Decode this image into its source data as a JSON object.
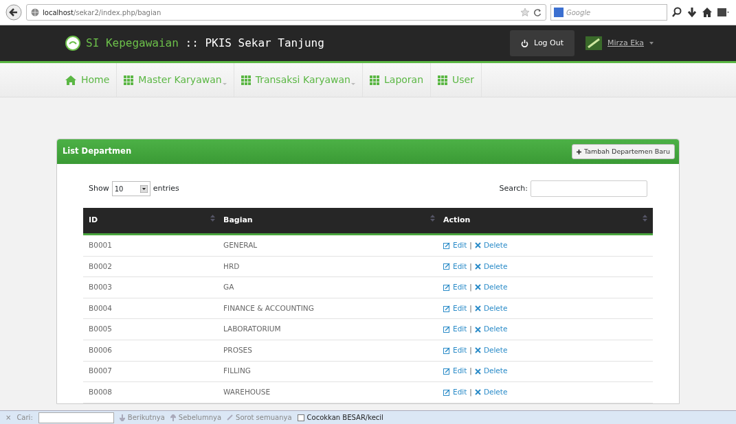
{
  "browser": {
    "url_host": "localhost",
    "url_path": "/sekar2/index.php/bagian",
    "search_placeholder": "Google"
  },
  "header": {
    "brand": "SI Kepegawaian",
    "brand_suffix": " :: PKIS Sekar Tanjung",
    "logout": "Log Out",
    "user": "Mirza Eka"
  },
  "nav": [
    {
      "label": "Home",
      "kind": "home",
      "dropdown": false
    },
    {
      "label": "Master Karyawan",
      "kind": "module",
      "dropdown": true
    },
    {
      "label": "Transaksi Karyawan",
      "kind": "module",
      "dropdown": true
    },
    {
      "label": "Laporan",
      "kind": "module",
      "dropdown": false
    },
    {
      "label": "User",
      "kind": "module",
      "dropdown": false
    }
  ],
  "panel": {
    "title": "List Departmen",
    "add_button": "Tambah Departemen Baru",
    "show_label": "Show",
    "page_size": "10",
    "entries_label": "entries",
    "search_label": "Search:"
  },
  "table": {
    "columns": [
      "ID",
      "Bagian",
      "Action"
    ],
    "rows": [
      {
        "id": "B0001",
        "bagian": "GENERAL",
        "edit": "Edit",
        "sep": "|",
        "delete": "Delete"
      },
      {
        "id": "B0002",
        "bagian": "HRD",
        "edit": "Edit",
        "sep": "|",
        "delete": "Delete"
      },
      {
        "id": "B0003",
        "bagian": "GA",
        "edit": "Edit",
        "sep": "|",
        "delete": "Delete"
      },
      {
        "id": "B0004",
        "bagian": "FINANCE & ACCOUNTING",
        "edit": "Edit",
        "sep": "|",
        "delete": "Delete"
      },
      {
        "id": "B0005",
        "bagian": "LABORATORIUM",
        "edit": "Edit",
        "sep": "|",
        "delete": "Delete"
      },
      {
        "id": "B0006",
        "bagian": "PROSES",
        "edit": "Edit",
        "sep": "|",
        "delete": "Delete"
      },
      {
        "id": "B0007",
        "bagian": "FILLING",
        "edit": "Edit",
        "sep": "|",
        "delete": "Delete"
      },
      {
        "id": "B0008",
        "bagian": "WAREHOUSE",
        "edit": "Edit",
        "sep": "|",
        "delete": "Delete"
      }
    ]
  },
  "find_bar": {
    "close": "×",
    "label": "Cari:",
    "next": "Berikutnya",
    "previous": "Sebelumnya",
    "highlight": "Sorot semuanya",
    "match_case": "Cocokkan BESAR/kecil",
    "match_case_checked": false
  }
}
